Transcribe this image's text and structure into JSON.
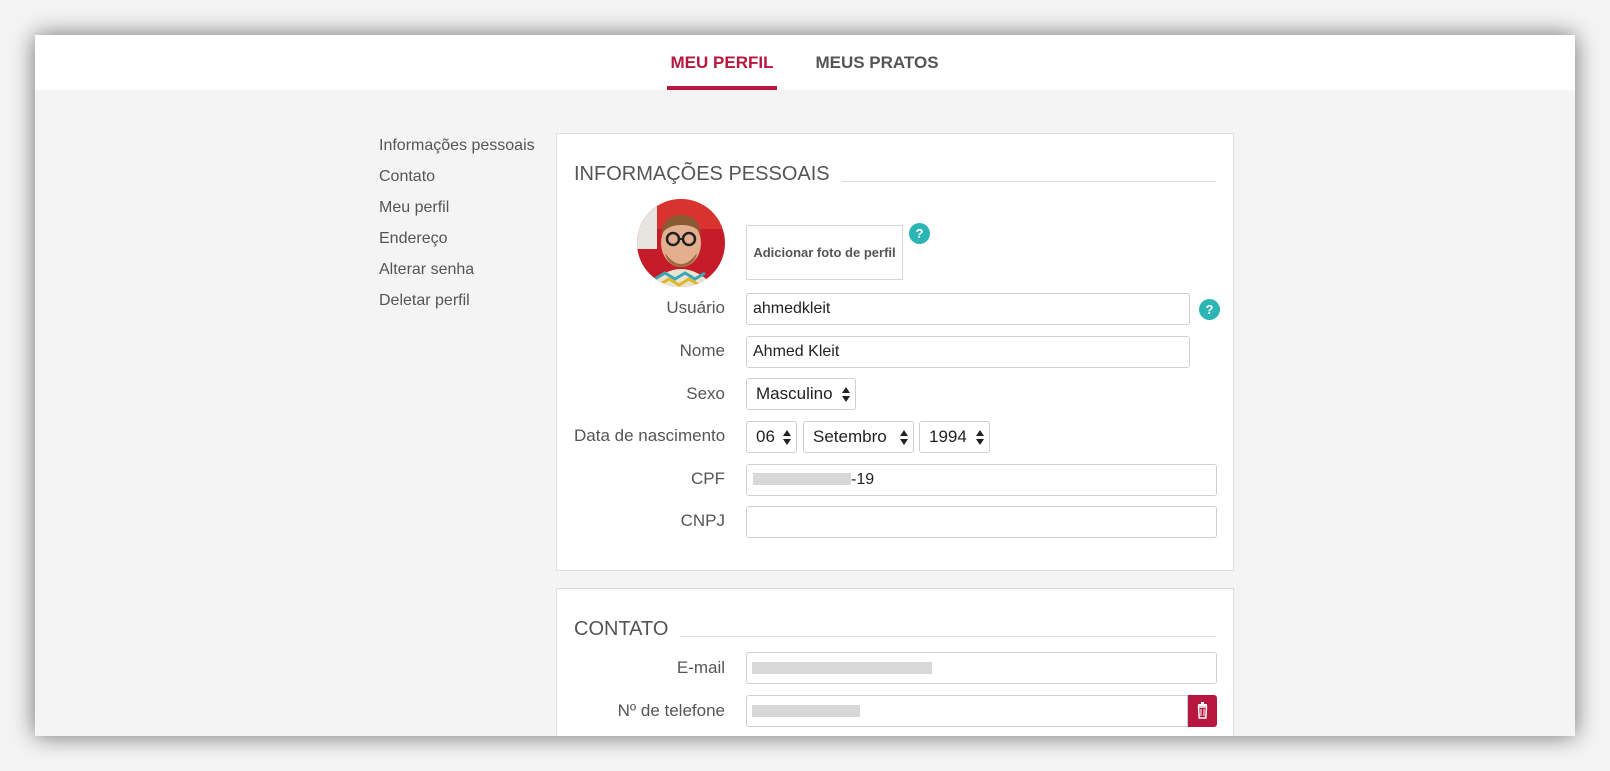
{
  "tabs": [
    {
      "label": "MEU PERFIL",
      "active": true
    },
    {
      "label": "MEUS PRATOS",
      "active": false
    }
  ],
  "sidebar": {
    "items": [
      {
        "label": "Informações pessoais"
      },
      {
        "label": "Contato"
      },
      {
        "label": "Meu perfil"
      },
      {
        "label": "Endereço"
      },
      {
        "label": "Alterar senha"
      },
      {
        "label": "Deletar perfil"
      }
    ]
  },
  "personal": {
    "title": "INFORMAÇÕES PESSOAIS",
    "photo_button": "Adicionar foto de perfil",
    "help_symbol": "?",
    "username": {
      "label": "Usuário",
      "value": "ahmedkleit"
    },
    "name": {
      "label": "Nome",
      "value": "Ahmed Kleit"
    },
    "sex": {
      "label": "Sexo",
      "value": "Masculino"
    },
    "birth": {
      "label": "Data de nascimento",
      "day": "06",
      "month": "Setembro",
      "year": "1994"
    },
    "cpf": {
      "label": "CPF",
      "value_suffix": "-19"
    },
    "cnpj": {
      "label": "CNPJ",
      "value": ""
    }
  },
  "contact": {
    "title": "CONTATO",
    "email": {
      "label": "E-mail"
    },
    "phone": {
      "label": "Nº de telefone"
    }
  },
  "colors": {
    "accent": "#b5173f",
    "help": "#2bb5b5",
    "background": "#f4f4f4"
  },
  "icons": [
    "help-icon",
    "trash-icon",
    "select-arrows-icon"
  ]
}
